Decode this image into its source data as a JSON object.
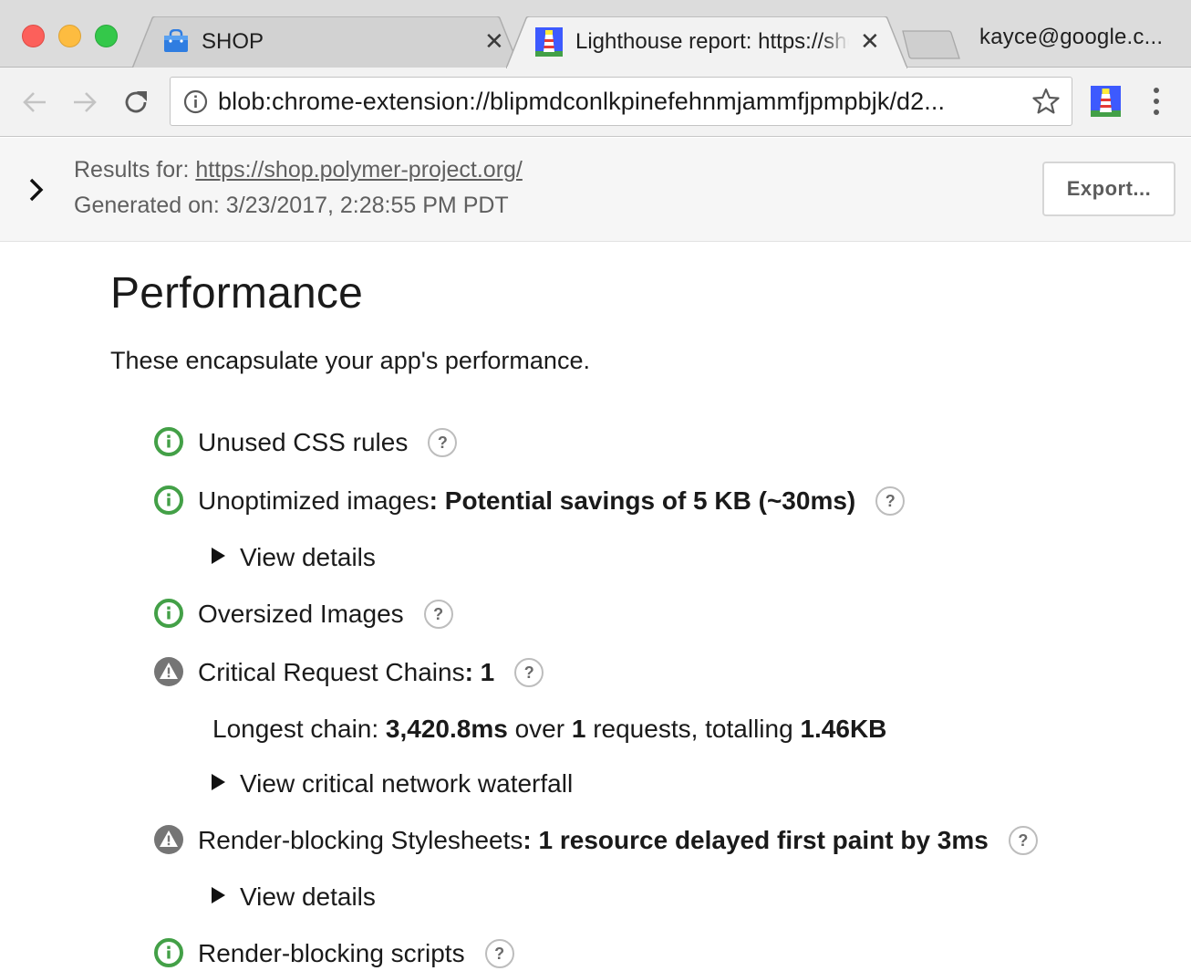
{
  "window": {
    "profile_name": "kayce@google.c..."
  },
  "tabs": [
    {
      "title": "SHOP",
      "icon": "shopping-bag-icon"
    },
    {
      "title": "Lighthouse report: https://shop.polymer-project.org/",
      "icon": "lighthouse-icon"
    }
  ],
  "toolbar": {
    "url": "blob:chrome-extension://blipmdconlkpinefehnmjammfjpmpbjk/d2...",
    "icons": [
      "back-arrow-icon",
      "forward-arrow-icon",
      "reload-icon",
      "info-icon",
      "star-icon",
      "lighthouse-extension-icon",
      "more-vert-icon"
    ]
  },
  "report_header": {
    "results_prefix": "Results for: ",
    "results_url": "https://shop.polymer-project.org/",
    "generated": "Generated on: 3/23/2017, 2:28:55 PM PDT",
    "export_label": "Export..."
  },
  "section": {
    "title": "Performance",
    "description": "These encapsulate your app's performance."
  },
  "audits": [
    {
      "status": "pass",
      "label": "Unused CSS rules",
      "value": ""
    },
    {
      "status": "pass",
      "label": "Unoptimized images",
      "value": ": Potential savings of 5 KB (~30ms)",
      "details": "View details"
    },
    {
      "status": "pass",
      "label": "Oversized Images",
      "value": ""
    },
    {
      "status": "warn",
      "label": "Critical Request Chains",
      "value": ": 1",
      "longest_chain": {
        "prefix": "Longest chain: ",
        "duration": "3,420.8ms",
        "over": " over ",
        "count": "1",
        "mid": " requests, totalling ",
        "size": "1.46KB"
      },
      "details": "View critical network waterfall"
    },
    {
      "status": "warn",
      "label": "Render-blocking Stylesheets",
      "value": ": 1 resource delayed first paint by 3ms",
      "details": "View details"
    },
    {
      "status": "pass",
      "label": "Render-blocking scripts",
      "value": ""
    }
  ],
  "help_glyph": "?",
  "colors": {
    "pass": "#43a047",
    "warn": "#757575",
    "tabstrip": "#dcdcdc",
    "toolbar": "#f2f2f2",
    "lighthouse_blue": "#3d5afe"
  }
}
